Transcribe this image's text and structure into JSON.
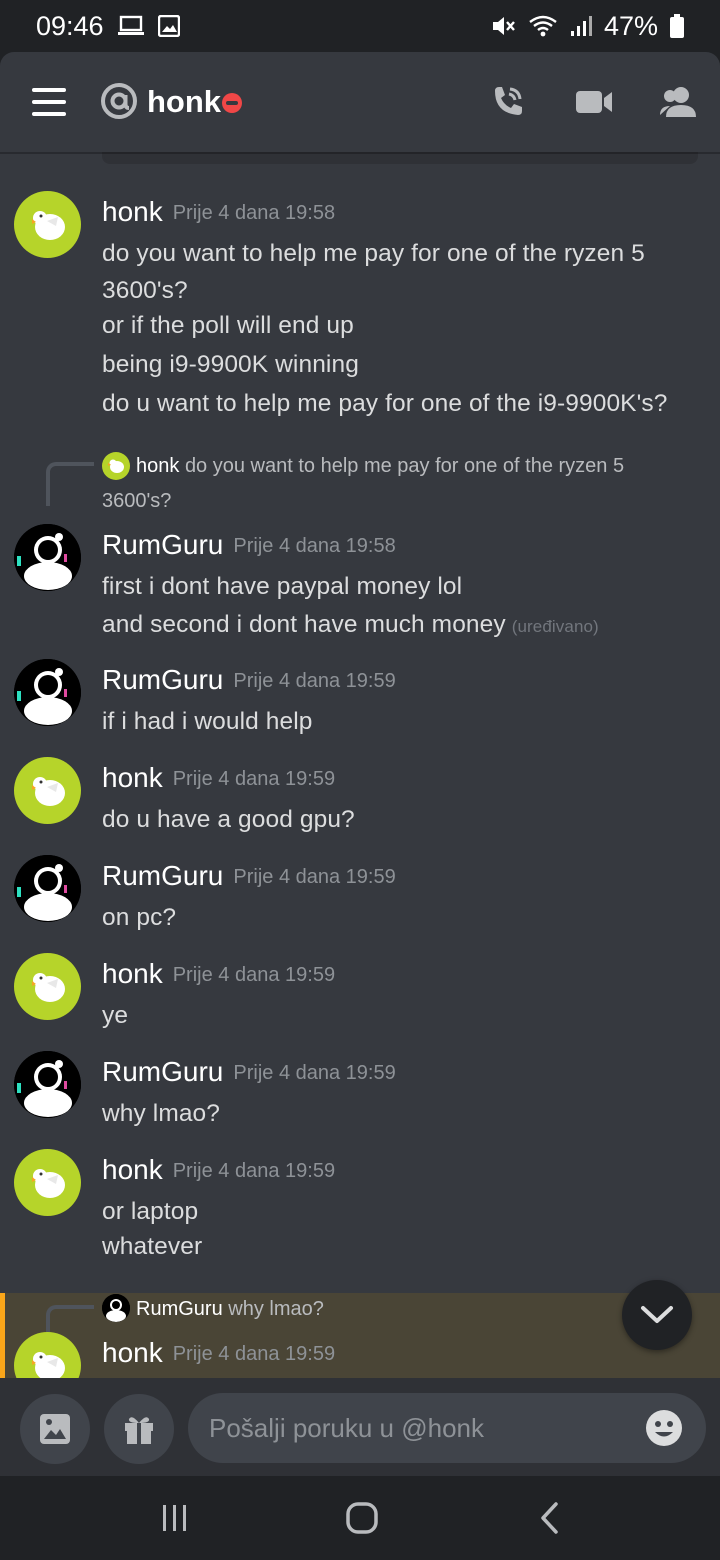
{
  "status_bar": {
    "time": "09:46",
    "battery": "47%",
    "icons": [
      "laptop-icon",
      "image-icon",
      "mute-icon",
      "wifi-icon",
      "signal-icon",
      "battery-icon"
    ]
  },
  "header": {
    "title": "honk",
    "status": "do-not-disturb",
    "icons": [
      "menu-icon",
      "at-icon",
      "call-icon",
      "video-icon",
      "members-icon"
    ]
  },
  "messages": [
    {
      "author": "honk",
      "timestamp": "Prije 4 dana 19:58",
      "lines": [
        "do you want to help me pay for one of the ryzen 5",
        "3600's?",
        "or if the poll will end up",
        "being i9-9900K winning",
        "do u want to help me pay for one of the i9-9900K's?"
      ]
    },
    {
      "reply": {
        "author": "honk",
        "text": "do you want to help me pay for one of the ryzen 5",
        "text_cont": "3600's?"
      },
      "author": "RumGuru",
      "timestamp": "Prije 4 dana 19:58",
      "lines": [
        "first i dont have paypal money lol",
        "and second i dont have much money"
      ],
      "edited": "(uređivano)"
    },
    {
      "author": "RumGuru",
      "timestamp": "Prije 4 dana 19:59",
      "lines": [
        "if i had i would help"
      ]
    },
    {
      "author": "honk",
      "timestamp": "Prije 4 dana 19:59",
      "lines": [
        "do u have a good gpu?"
      ]
    },
    {
      "author": "RumGuru",
      "timestamp": "Prije 4 dana 19:59",
      "lines": [
        "on pc?"
      ]
    },
    {
      "author": "honk",
      "timestamp": "Prije 4 dana 19:59",
      "lines": [
        "ye"
      ]
    },
    {
      "author": "RumGuru",
      "timestamp": "Prije 4 dana 19:59",
      "lines": [
        "why lmao?"
      ]
    },
    {
      "author": "honk",
      "timestamp": "Prije 4 dana 19:59",
      "lines": [
        "or laptop",
        "whatever"
      ]
    },
    {
      "reply": {
        "author": "RumGuru",
        "text": "why lmao?"
      },
      "author": "honk",
      "timestamp": "Prije 4 dana 19:59",
      "lines": []
    }
  ],
  "input": {
    "placeholder": "Pošalji poruku u @honk"
  },
  "colors": {
    "background": "#36393f",
    "header_dark": "#202225",
    "dnd_red": "#f04747",
    "mention_highlight": "#faa61a",
    "honk_avatar": "#b6d42a"
  }
}
